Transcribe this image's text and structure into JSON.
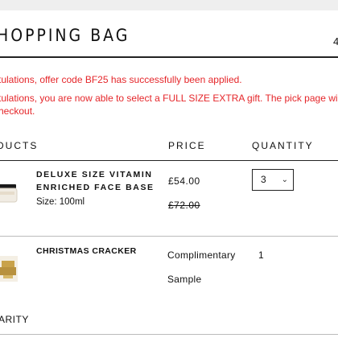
{
  "bag": {
    "title": "HOPPING BAG",
    "item_count": "4"
  },
  "messages": {
    "offer_applied": "tulations, offer code BF25 has successfully been applied.",
    "gift_line1": "tulations, you are now able to select a FULL SIZE EXTRA gift. The pick page wil",
    "gift_line2": "heckout."
  },
  "table": {
    "headers": {
      "products": "DUCTS",
      "price": "PRICE",
      "quantity": "QUANTITY"
    }
  },
  "items": [
    {
      "name": "DELUXE SIZE VITAMIN ENRICHED FACE BASE",
      "size": "Size: 100ml",
      "price": "£54.00",
      "was_price": "£72.00",
      "quantity": "3"
    },
    {
      "name": "CHRISTMAS CRACKER",
      "price_line1": "Complimentary",
      "price_line2": "Sample",
      "quantity": "1"
    }
  ],
  "footer": {
    "charity_label": "ARITY"
  },
  "colors": {
    "alert": "#e5262a",
    "rule": "#222222"
  }
}
